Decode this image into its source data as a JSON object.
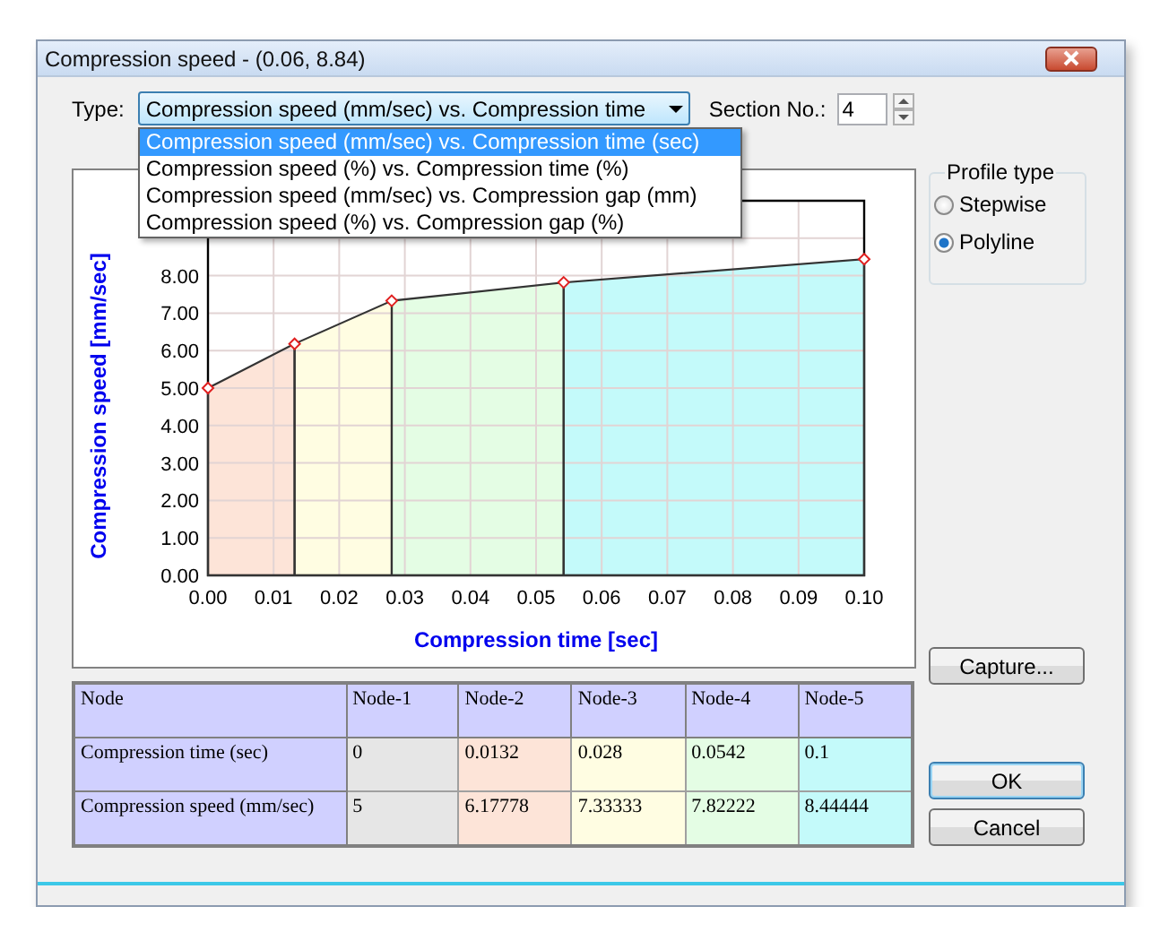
{
  "window": {
    "title": "Compression speed - (0.06, 8.84)"
  },
  "type_field": {
    "label": "Type:",
    "value": "Compression speed (mm/sec) vs. Compression time",
    "expanded": true
  },
  "type_options": [
    {
      "label": "Compression speed (mm/sec) vs. Compression time (sec)",
      "selected": true
    },
    {
      "label": "Compression speed (%) vs. Compression time (%)",
      "selected": false
    },
    {
      "label": "Compression speed (mm/sec) vs. Compression gap (mm)",
      "selected": false
    },
    {
      "label": "Compression speed (%) vs. Compression gap (%)",
      "selected": false
    }
  ],
  "section": {
    "label": "Section No.:",
    "value": "4"
  },
  "chart": {
    "chart_data": {
      "type": "area",
      "xlabel": "Compression time [sec]",
      "ylabel": "Compression speed [mm/sec]",
      "x": [
        0,
        0.0132,
        0.028,
        0.0542,
        0.1
      ],
      "series": [
        {
          "color": "#fde4d8",
          "marker": "diamond",
          "values": [
            5,
            6.18,
            null,
            null,
            null
          ]
        },
        {
          "color": "#fffde2",
          "marker": "diamond",
          "values": [
            null,
            6.18,
            7.33,
            null,
            null
          ]
        },
        {
          "color": "#e4fde4",
          "marker": "diamond",
          "values": [
            null,
            null,
            7.33,
            7.82,
            null
          ]
        },
        {
          "color": "#c4fafa",
          "marker": "diamond",
          "values": [
            null,
            null,
            null,
            7.82,
            8.44
          ]
        }
      ],
      "grid": true,
      "xlim": [
        0,
        0.1
      ],
      "ylim": [
        0,
        10
      ],
      "xticks": [
        {
          "value": 0,
          "label": "0.00"
        },
        {
          "value": 0.01,
          "label": "0.01"
        },
        {
          "value": 0.02,
          "label": "0.02"
        },
        {
          "value": 0.03,
          "label": "0.03"
        },
        {
          "value": 0.04,
          "label": "0.04"
        },
        {
          "value": 0.05,
          "label": "0.05"
        },
        {
          "value": 0.06,
          "label": "0.06"
        },
        {
          "value": 0.07,
          "label": "0.07"
        },
        {
          "value": 0.08,
          "label": "0.08"
        },
        {
          "value": 0.09,
          "label": "0.09"
        },
        {
          "value": 0.1,
          "label": "0.10"
        }
      ],
      "yticks": [
        {
          "value": 0,
          "label": "0.00"
        },
        {
          "value": 1,
          "label": "1.00"
        },
        {
          "value": 2,
          "label": "2.00"
        },
        {
          "value": 3,
          "label": "3.00"
        },
        {
          "value": 4,
          "label": "4.00"
        },
        {
          "value": 5,
          "label": "5.00"
        },
        {
          "value": 6,
          "label": "6.00"
        },
        {
          "value": 7,
          "label": "7.00"
        },
        {
          "value": 8,
          "label": "8.00"
        }
      ]
    }
  },
  "profile_type": {
    "title": "Profile type",
    "options": [
      {
        "label": "Stepwise",
        "selected": false
      },
      {
        "label": "Polyline",
        "selected": true
      }
    ]
  },
  "table": {
    "columns": [
      {
        "label": "Node"
      },
      {
        "label": "Node-1",
        "color": "#e6e6e6"
      },
      {
        "label": "Node-2",
        "color": "#fde4d8"
      },
      {
        "label": "Node-3",
        "color": "#fffde2"
      },
      {
        "label": "Node-4",
        "color": "#e4fde4"
      },
      {
        "label": "Node-5",
        "color": "#c4fafa"
      }
    ],
    "rows": [
      {
        "cells": [
          "Compression time (sec)",
          "0",
          "0.0132",
          "0.028",
          "0.0542",
          "0.1"
        ]
      },
      {
        "cells": [
          "Compression speed (mm/sec)",
          "5",
          "6.17778",
          "7.33333",
          "7.82222",
          "8.44444"
        ]
      }
    ]
  },
  "buttons": {
    "capture": "Capture...",
    "ok": "OK",
    "cancel": "Cancel"
  }
}
